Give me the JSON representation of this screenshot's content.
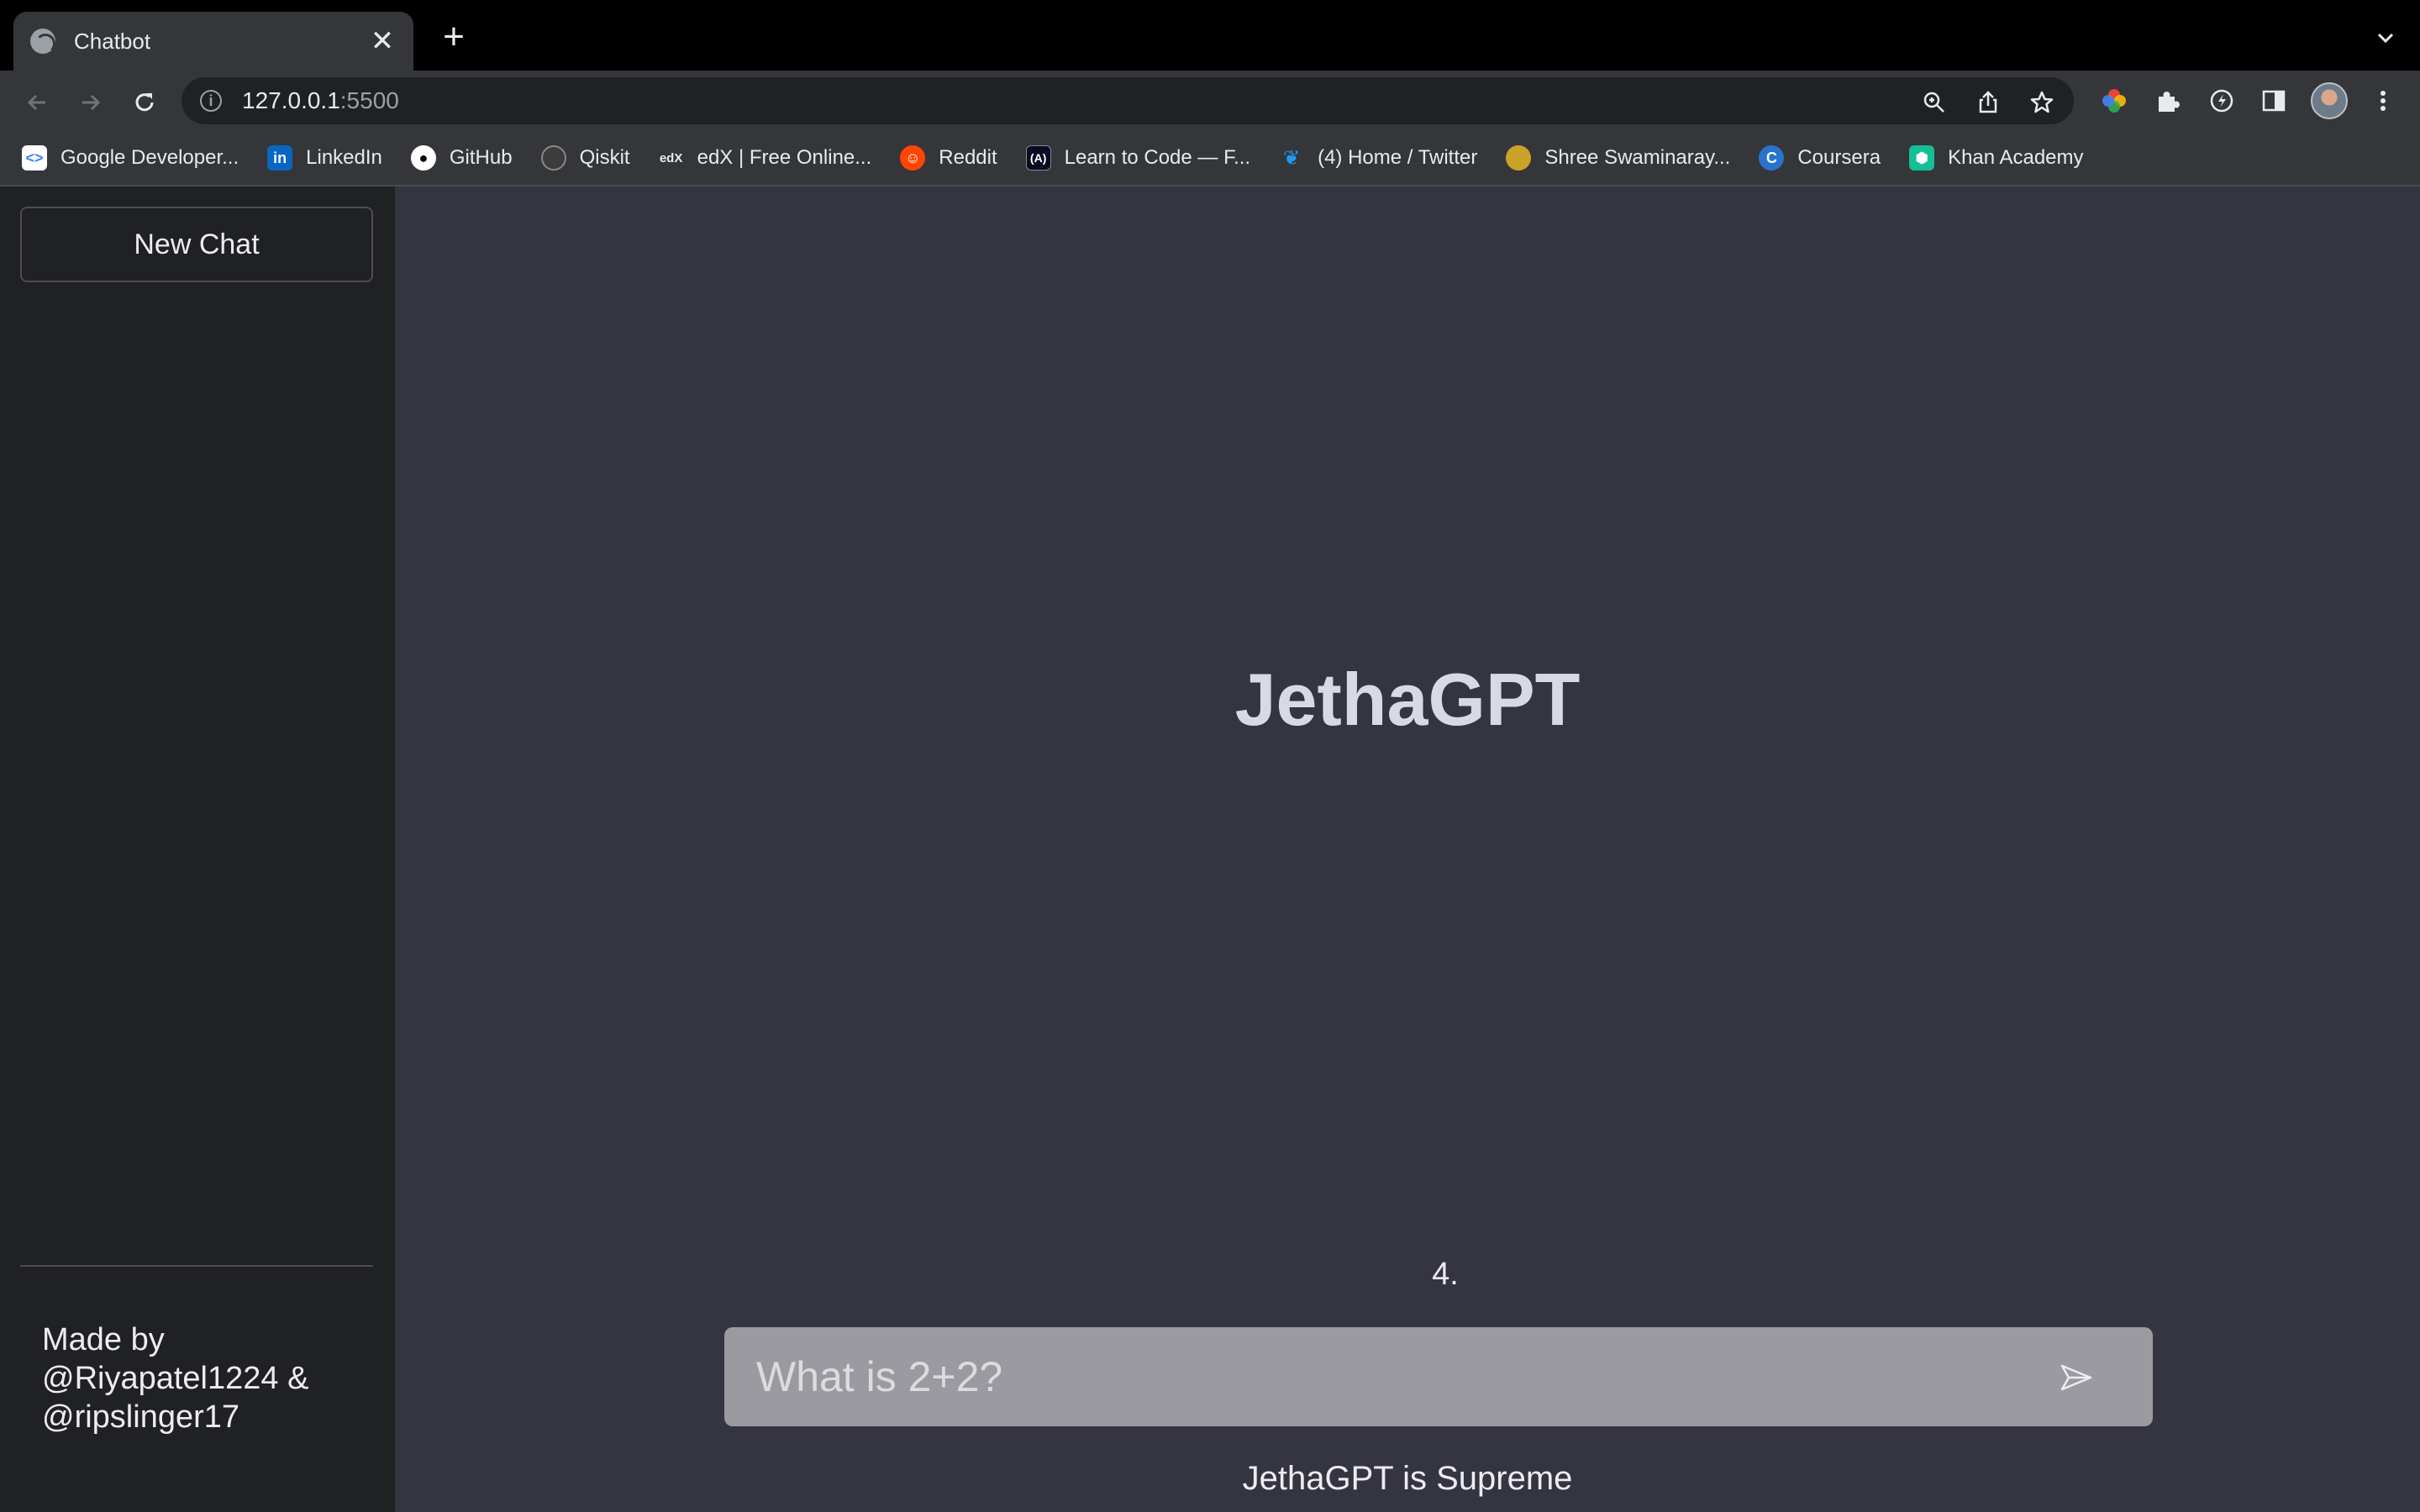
{
  "browser": {
    "tab": {
      "title": "Chatbot",
      "close": "✕"
    },
    "new_tab": "+",
    "url": {
      "host": "127.0.0.1",
      "port": ":5500"
    },
    "bookmarks": [
      {
        "label": "Google Developer...",
        "icon": "google-developers-icon",
        "color": "#ffffff"
      },
      {
        "label": "LinkedIn",
        "icon": "linkedin-icon",
        "color": "#0a66c2"
      },
      {
        "label": "GitHub",
        "icon": "github-icon",
        "color": "#ffffff"
      },
      {
        "label": "Qiskit",
        "icon": "qiskit-icon",
        "color": "#3c3c3c"
      },
      {
        "label": "edX | Free Online...",
        "icon": "edx-icon",
        "color": "#35363a"
      },
      {
        "label": "Reddit",
        "icon": "reddit-icon",
        "color": "#ff4500"
      },
      {
        "label": "Learn to Code — F...",
        "icon": "freecodecamp-icon",
        "color": "#0a0a23"
      },
      {
        "label": "(4) Home / Twitter",
        "icon": "twitter-icon",
        "color": "#1d9bf0"
      },
      {
        "label": "Shree Swaminaray...",
        "icon": "swaminarayan-icon",
        "color": "#c9a227"
      },
      {
        "label": "Coursera",
        "icon": "coursera-icon",
        "color": "#2a73cc"
      },
      {
        "label": "Khan Academy",
        "icon": "khan-academy-icon",
        "color": "#14bf96"
      }
    ]
  },
  "sidebar": {
    "new_chat_label": "New Chat",
    "credits": "Made by\n@Riyapatel1224 &\n@ripslinger17"
  },
  "main": {
    "title": "JethaGPT",
    "answer": "4.",
    "input_placeholder": "What is 2+2?",
    "footer": "JethaGPT is Supreme"
  }
}
